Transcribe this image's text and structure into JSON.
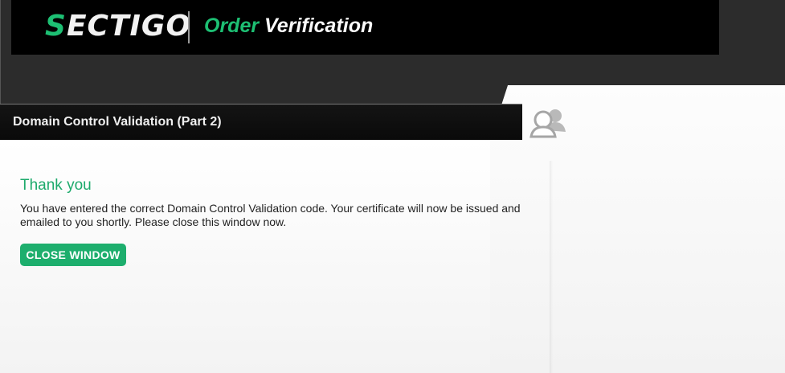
{
  "header": {
    "logo_first": "S",
    "logo_rest": "ECTIGO",
    "title_part1": "Order",
    "title_part2": "Verification"
  },
  "tab": {
    "label": "Domain Control Validation (Part 2)"
  },
  "content": {
    "heading": "Thank you",
    "message": "You have entered the correct Domain Control Validation code. Your certificate will now be issued and emailed to you shortly. Please close this window now.",
    "close_button": "CLOSE WINDOW"
  },
  "icons": {
    "users": "users-icon"
  },
  "colors": {
    "accent": "#1dae6d",
    "header_bg": "#000000",
    "page_bg": "#2c2c2c"
  }
}
